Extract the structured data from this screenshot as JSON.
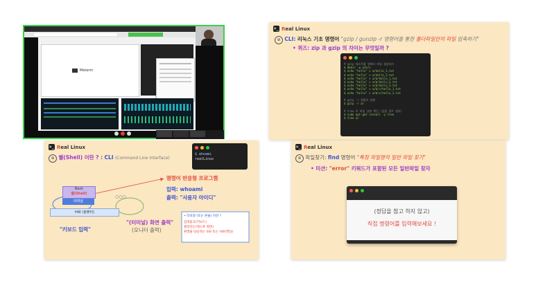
{
  "brand": {
    "name_r": "R",
    "name_rest": "eal Linux"
  },
  "video": {
    "app_name": "Meterm",
    "stop_label": "■"
  },
  "slide_cli": {
    "label": "CLI:",
    "heading_plain": "리눅스 기초 명령어",
    "heading_quote": "\"gzip / gunzip -r 명령어를 통한",
    "heading_red": "폴더파일안의 파일",
    "heading_tail": "압축하기\"",
    "quiz": "• 퀴즈: zip 과 gzip 의 차이는 무엇일까 ?",
    "terminal_lines": [
      {
        "text": "# gzip 테스트를 위해서 파일 생성하기",
        "cls": "grey"
      },
      {
        "text": "$ mkdir -p a/b/c",
        "cls": "green"
      },
      {
        "text": "$ echo \"hello\" > a/hello_1.txt",
        "cls": "green"
      },
      {
        "text": "$ echo \"hello\" > a/hello_2.txt",
        "cls": "green"
      },
      {
        "text": "$ echo \"hello\" > a/b/hello_1.txt",
        "cls": "green"
      },
      {
        "text": "$ echo \"hello\" > a/b/hello_2.txt",
        "cls": "green"
      },
      {
        "text": "$ echo \"hello\" > a/b/hello_3.txt",
        "cls": "green"
      },
      {
        "text": "$ echo \"hello\" > a/b/c/hello_1.txt",
        "cls": "green"
      },
      {
        "text": "$ echo \"hello\" > a/b/c/hello_2.txt",
        "cls": "green"
      },
      {
        "text": "",
        "cls": ""
      },
      {
        "text": "# gzip -r 명령어 실행",
        "cls": "grey"
      },
      {
        "text": "$ gzip -r a/",
        "cls": "green"
      },
      {
        "text": "",
        "cls": ""
      },
      {
        "text": "# tree 로 파일 상태 확인 (없을 경우 설치)",
        "cls": "grey"
      },
      {
        "text": "$ sudo apt-get install -y tree",
        "cls": "green"
      },
      {
        "text": "$ tree a/",
        "cls": "green"
      }
    ]
  },
  "slide_shell": {
    "title_part1": "쉘(Shell) 이란 ? :",
    "title_cli": "CLI",
    "title_sub": "(Command Line Interface)",
    "term_lines": [
      "$ whoami",
      "realLinux"
    ],
    "reactive": "명령어 반응형 프로그램",
    "input_label": "입력:",
    "input_value": "whoami",
    "output_label": "출력:",
    "output_value": "\"사용자 아이디\"",
    "bash_label": "Bash",
    "shell_label": "쉘(Shell)",
    "terminal_label": "터미널",
    "hw_label": "HW (컴퓨터)",
    "dots": "○○○",
    "keyboard_label": "\"키보드 입력\"",
    "screen_output": "\"(터미널) 화면 출력\"",
    "monitor_output": "(모니터 출력)",
    "box_title": "• 터미널 (또는 콘솔) 이란 ?",
    "box_line1": "입력받고(키보드)",
    "box_line2": "출력하는(텍스트 화면)",
    "box_line3": "환경을 담당하는 SW 또는 HW(옛날)"
  },
  "slide_find": {
    "label": "파일찾기:",
    "cmd": "find",
    "label2": "명령어",
    "quote": "\"특정 파일명의 일반 파일 찾기\"",
    "mission_prefix": "• 미션:",
    "mission_error": "\"error\"",
    "mission_suffix": "키워드가 포함된 모든 일반파일 찾자",
    "hint1": "(정답을 참고 하지 않고)",
    "hint2": "직접 명령어를 입력해보세요 !"
  }
}
